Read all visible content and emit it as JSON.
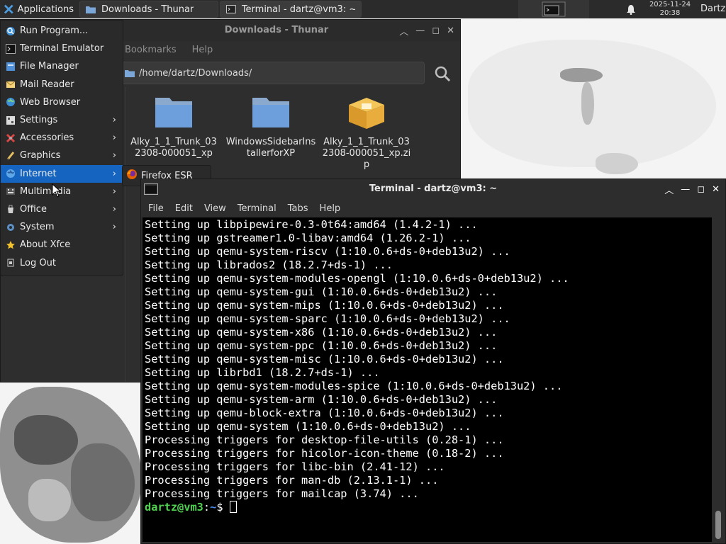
{
  "panel": {
    "applications_label": "Applications",
    "tasks": [
      {
        "label": "Downloads - Thunar",
        "icon": "folder-icon"
      },
      {
        "label": "Terminal - dartz@vm3: ~",
        "icon": "terminal-icon"
      }
    ],
    "clock": {
      "date": "2025-11-24",
      "time": "20:38"
    },
    "user": "Dartz"
  },
  "apps_menu": {
    "items": [
      {
        "label": "Run Program...",
        "icon": "search-icon",
        "submenu": false
      },
      {
        "label": "Terminal Emulator",
        "icon": "terminal-icon",
        "submenu": false
      },
      {
        "label": "File Manager",
        "icon": "file-manager-icon",
        "submenu": false
      },
      {
        "label": "Mail Reader",
        "icon": "mail-icon",
        "submenu": false
      },
      {
        "label": "Web Browser",
        "icon": "globe-icon",
        "submenu": false
      },
      {
        "label": "Settings",
        "icon": "settings-icon",
        "submenu": true
      },
      {
        "label": "Accessories",
        "icon": "accessories-icon",
        "submenu": true
      },
      {
        "label": "Graphics",
        "icon": "graphics-icon",
        "submenu": true
      },
      {
        "label": "Internet",
        "icon": "globe-icon",
        "submenu": true,
        "active": true
      },
      {
        "label": "Multimedia",
        "icon": "multimedia-icon",
        "submenu": true
      },
      {
        "label": "Office",
        "icon": "office-icon",
        "submenu": true
      },
      {
        "label": "System",
        "icon": "gear-icon",
        "submenu": true
      },
      {
        "label": "About Xfce",
        "icon": "star-icon",
        "submenu": false
      },
      {
        "label": "Log Out",
        "icon": "logout-icon",
        "submenu": false
      }
    ],
    "internet_submenu": [
      {
        "label": "Firefox ESR",
        "icon": "firefox-icon"
      }
    ]
  },
  "thunar": {
    "title": "Downloads - Thunar",
    "menu": [
      "Bookmarks",
      "Help"
    ],
    "location": "/home/dartz/Downloads/",
    "files": [
      {
        "name": "Alky_1_1_Trunk_032308-000051_xp",
        "icon": "folder-icon"
      },
      {
        "name": "WindowsSidebarInstallerforXP",
        "icon": "folder-icon"
      },
      {
        "name": "Alky_1_1_Trunk_032308-000051_xp.zip",
        "icon": "archive-icon"
      }
    ]
  },
  "terminal": {
    "title": "Terminal - dartz@vm3: ~",
    "menu": [
      "File",
      "Edit",
      "View",
      "Terminal",
      "Tabs",
      "Help"
    ],
    "lines": [
      "Setting up libpipewire-0.3-0t64:amd64 (1.4.2-1) ...",
      "Setting up gstreamer1.0-libav:amd64 (1.26.2-1) ...",
      "Setting up qemu-system-riscv (1:10.0.6+ds-0+deb13u2) ...",
      "Setting up librados2 (18.2.7+ds-1) ...",
      "Setting up qemu-system-modules-opengl (1:10.0.6+ds-0+deb13u2) ...",
      "Setting up qemu-system-gui (1:10.0.6+ds-0+deb13u2) ...",
      "Setting up qemu-system-mips (1:10.0.6+ds-0+deb13u2) ...",
      "Setting up qemu-system-sparc (1:10.0.6+ds-0+deb13u2) ...",
      "Setting up qemu-system-x86 (1:10.0.6+ds-0+deb13u2) ...",
      "Setting up qemu-system-ppc (1:10.0.6+ds-0+deb13u2) ...",
      "Setting up qemu-system-misc (1:10.0.6+ds-0+deb13u2) ...",
      "Setting up librbd1 (18.2.7+ds-1) ...",
      "Setting up qemu-system-modules-spice (1:10.0.6+ds-0+deb13u2) ...",
      "Setting up qemu-system-arm (1:10.0.6+ds-0+deb13u2) ...",
      "Setting up qemu-block-extra (1:10.0.6+ds-0+deb13u2) ...",
      "Setting up qemu-system (1:10.0.6+ds-0+deb13u2) ...",
      "Processing triggers for desktop-file-utils (0.28-1) ...",
      "Processing triggers for hicolor-icon-theme (0.18-2) ...",
      "Processing triggers for libc-bin (2.41-12) ...",
      "Processing triggers for man-db (2.13.1-1) ...",
      "Processing triggers for mailcap (3.74) ..."
    ],
    "prompt": {
      "user_host": "dartz@vm3",
      "separator": ":",
      "path": "~",
      "symbol": "$ "
    }
  },
  "colors": {
    "accent": "#1565c0",
    "prompt_user": "#4fd24f",
    "prompt_path": "#4b8ef0"
  }
}
